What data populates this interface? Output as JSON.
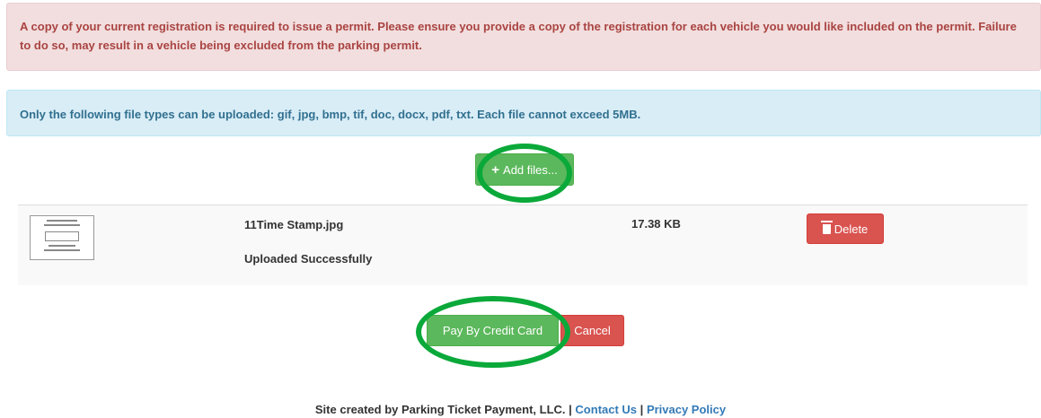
{
  "alerts": {
    "danger_text": "A copy of your current registration is required to issue a permit. Please ensure you provide a copy of the registration for each vehicle you would like included on the permit. Failure to do so, may result in a vehicle being excluded from the parking permit.",
    "info_text": "Only the following file types can be uploaded: gif, jpg, bmp, tif, doc, docx, pdf, txt. Each file cannot exceed 5MB."
  },
  "upload": {
    "add_files_label": "Add files...",
    "add_icon": "plus-icon"
  },
  "files": [
    {
      "thumbnail_icon": "document-thumbnail",
      "name": "11Time Stamp.jpg",
      "status": "Uploaded Successfully",
      "size": "17.38 KB",
      "delete_label": "Delete",
      "delete_icon": "trash-icon"
    }
  ],
  "actions": {
    "pay_label": "Pay By Credit Card",
    "cancel_label": "Cancel"
  },
  "footer": {
    "credit": "Site created by Parking Ticket Payment, LLC.",
    "separator": "|",
    "contact_label": "Contact Us",
    "privacy_label": "Privacy Policy"
  },
  "colors": {
    "success": "#5cb85c",
    "danger": "#d9534f",
    "highlight_ring": "#0aa93a",
    "link": "#337ab7"
  }
}
